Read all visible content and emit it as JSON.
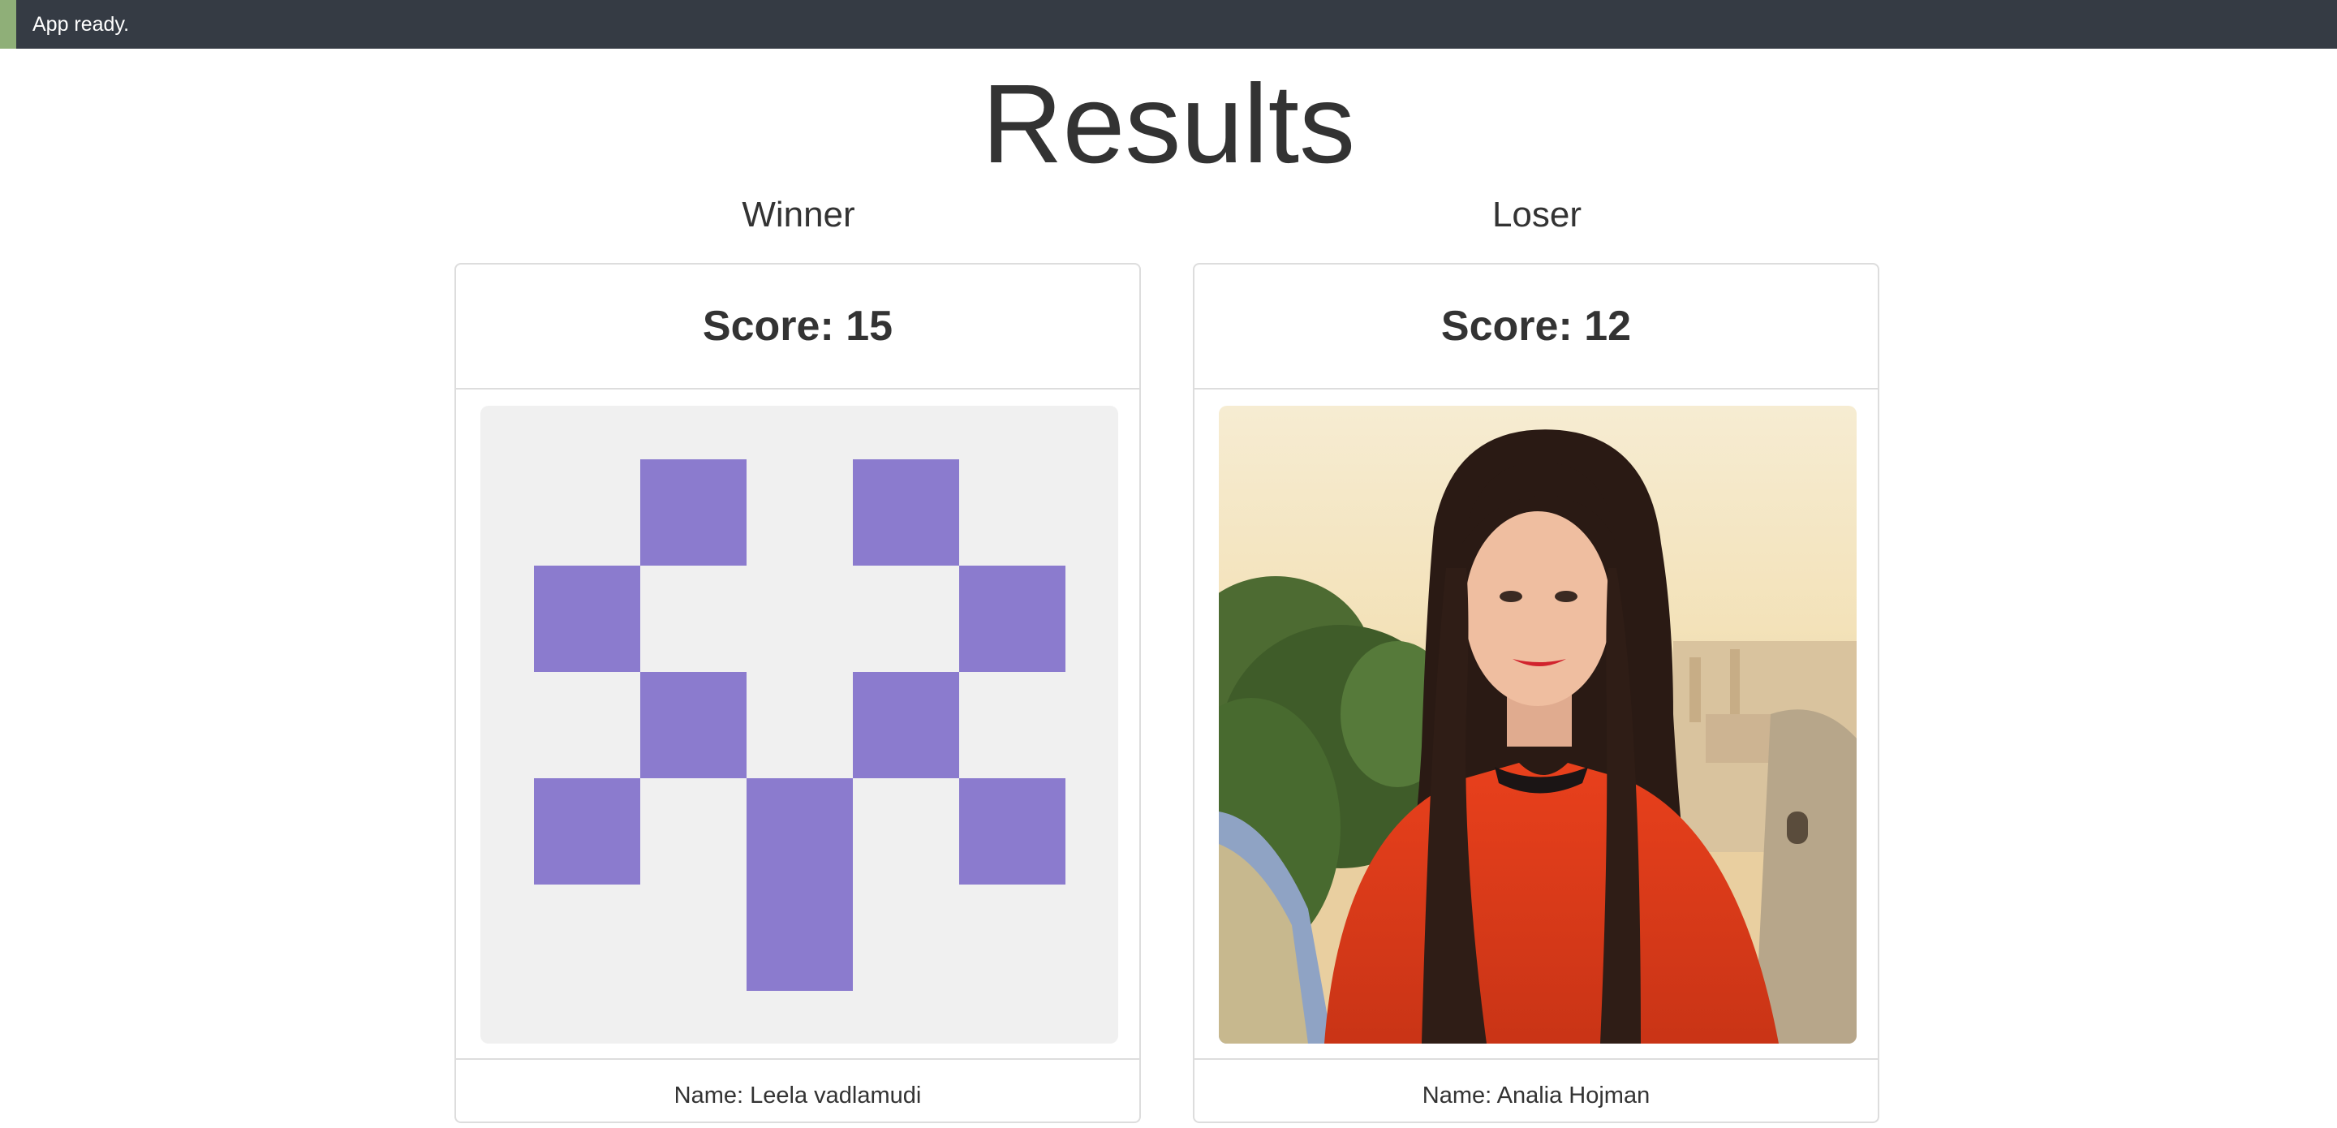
{
  "status": {
    "text": "App ready.",
    "bar_color": "#353b44",
    "accent_color": "#8faf78"
  },
  "page": {
    "title": "Results"
  },
  "winner": {
    "label": "Winner",
    "score": "Score: 15",
    "name": "Name: Leela vadlamudi",
    "avatar": "identicon",
    "identicon_color": "#8b7bce",
    "identicon_background": "#f0f0f0"
  },
  "loser": {
    "label": "Loser",
    "score": "Score: 12",
    "name": "Name: Analia Hojman",
    "avatar": "photo-portrait"
  }
}
